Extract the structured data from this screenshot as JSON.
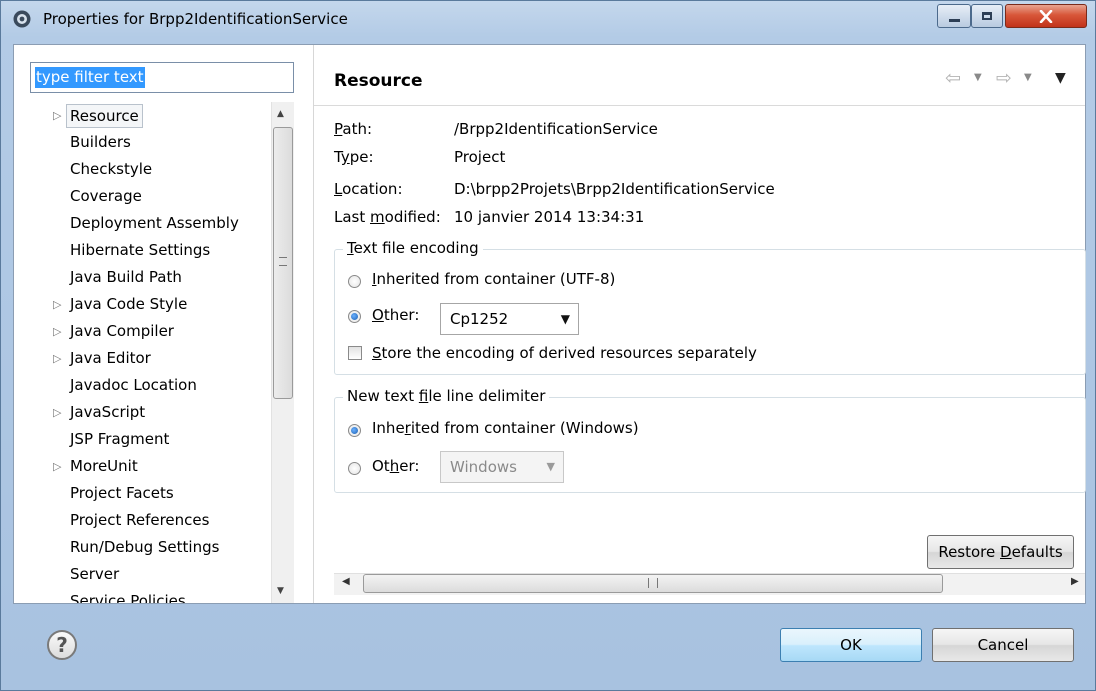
{
  "window": {
    "title": "Properties for Brpp2IdentificationService"
  },
  "filter": {
    "value": "type filter text"
  },
  "tree": {
    "items": [
      {
        "label": "Resource",
        "expandable": true,
        "selected": true
      },
      {
        "label": "Builders",
        "expandable": false
      },
      {
        "label": "Checkstyle",
        "expandable": false
      },
      {
        "label": "Coverage",
        "expandable": false
      },
      {
        "label": "Deployment Assembly",
        "expandable": false
      },
      {
        "label": "Hibernate Settings",
        "expandable": false
      },
      {
        "label": "Java Build Path",
        "expandable": false
      },
      {
        "label": "Java Code Style",
        "expandable": true
      },
      {
        "label": "Java Compiler",
        "expandable": true
      },
      {
        "label": "Java Editor",
        "expandable": true
      },
      {
        "label": "Javadoc Location",
        "expandable": false
      },
      {
        "label": "JavaScript",
        "expandable": true
      },
      {
        "label": "JSP Fragment",
        "expandable": false
      },
      {
        "label": "MoreUnit",
        "expandable": true
      },
      {
        "label": "Project Facets",
        "expandable": false
      },
      {
        "label": "Project References",
        "expandable": false
      },
      {
        "label": "Run/Debug Settings",
        "expandable": false
      },
      {
        "label": "Server",
        "expandable": false
      },
      {
        "label": "Service Policies",
        "expandable": false
      }
    ]
  },
  "panel": {
    "title": "Resource",
    "path_label": "Path:",
    "path_value": "/Brpp2IdentificationService",
    "type_label": "Type:",
    "type_value": "Project",
    "location_label": "Location:",
    "location_value": "D:\\brpp2Projets\\Brpp2IdentificationService",
    "modified_label": "Last modified:",
    "modified_value": "10 janvier 2014 13:34:31"
  },
  "encoding": {
    "group_title": "Text file encoding",
    "inherited_label": "Inherited from container (UTF-8)",
    "other_label": "Other:",
    "other_value": "Cp1252",
    "store_label": "Store the encoding of derived resources separately"
  },
  "delimiter": {
    "group_title": "New text file line delimiter",
    "inherited_label": "Inherited from container (Windows)",
    "other_label": "Other:",
    "other_value": "Windows"
  },
  "buttons": {
    "restore": "Restore Defaults",
    "ok": "OK",
    "cancel": "Cancel"
  },
  "colors": {
    "selection": "#3399ff",
    "close_button": "#c1321a",
    "default_button_border": "#3c7fb1"
  }
}
